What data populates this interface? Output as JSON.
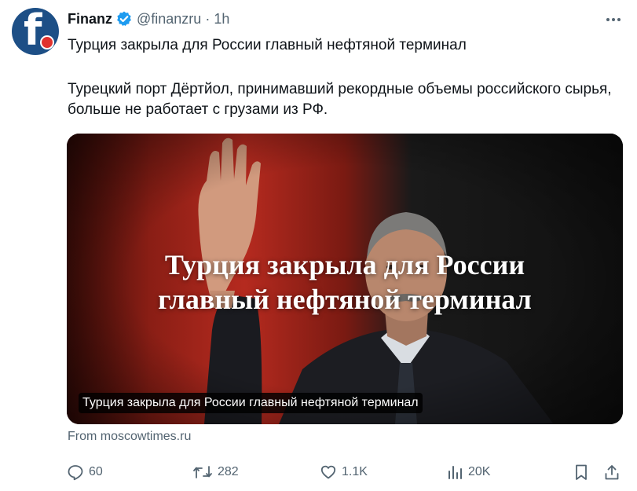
{
  "tweet": {
    "author_name": "Finanz",
    "author_handle": "@finanzru",
    "separator": "·",
    "time": "1h",
    "avatar_letter": "f.",
    "text_line1": "Турция закрыла для России главный нефтяной терминал",
    "text_line2": "Турецкий порт Дёртйол, принимавший рекордные объемы российского сырья, больше не работает с грузами из РФ."
  },
  "card": {
    "overlay_title_line1": "Турция закрыла для России",
    "overlay_title_line2": "главный нефтяной терминал",
    "caption": "Турция закрыла для России главный нефтяной терминал",
    "source": "From moscowtimes.ru"
  },
  "actions": {
    "replies": "60",
    "retweets": "282",
    "likes": "1.1K",
    "views": "20K"
  },
  "colors": {
    "text_primary": "#0f1419",
    "text_secondary": "#536471",
    "verified_blue": "#1d9bf0",
    "avatar_bg": "#1d4f86",
    "avatar_dot": "#e0312e",
    "card_red": "#b52a1f"
  }
}
